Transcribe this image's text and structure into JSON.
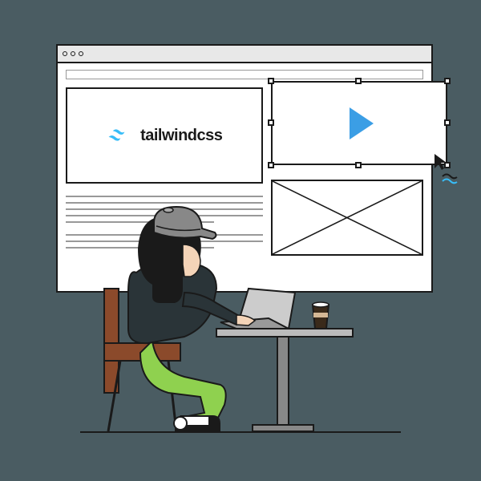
{
  "brand": {
    "name": "tailwindcss"
  }
}
